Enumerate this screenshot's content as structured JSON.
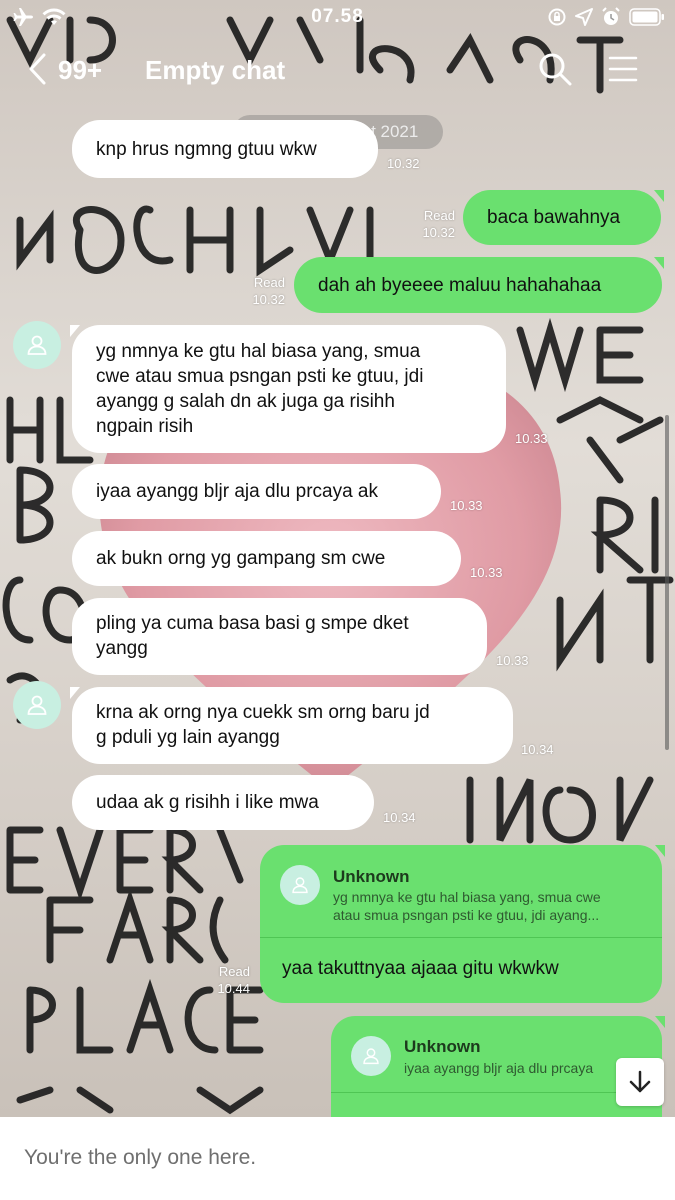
{
  "status_bar": {
    "time": "07.58"
  },
  "header": {
    "unread_count": "99+",
    "title": "Empty chat"
  },
  "date_chip": "Mon, 16 August 2021",
  "messages": [
    {
      "text": "knp hrus ngmng gtuu wkw",
      "time": "10.32"
    },
    {
      "text": "baca bawahnya",
      "read": "Read",
      "time": "10.32"
    },
    {
      "text": "dah ah byeeee maluu hahahahaa",
      "read": "Read",
      "time": "10.32"
    },
    {
      "text_lines": [
        "yg nmnya ke gtu hal biasa yang, smua",
        "cwe atau smua psngan psti ke gtuu, jdi",
        "ayangg g salah dn ak juga ga risihh",
        "ngpain risih"
      ],
      "time": "10.33"
    },
    {
      "text": "iyaa ayangg bljr aja dlu prcaya ak",
      "time": "10.33"
    },
    {
      "text": "ak bukn orng yg gampang sm cwe",
      "time": "10.33"
    },
    {
      "text_lines": [
        "pling ya cuma basa basi g smpe dket",
        "yangg"
      ],
      "time": "10.33"
    },
    {
      "text_lines": [
        "krna ak orng nya cuekk sm orng baru jd",
        "g pduli yg lain ayangg"
      ],
      "time": "10.34"
    },
    {
      "text": "udaa ak g risihh i like mwa",
      "time": "10.34"
    }
  ],
  "replies": [
    {
      "name": "Unknown",
      "snippet_lines": [
        "yg nmnya ke gtu hal biasa yang, smua cwe",
        "atau smua psngan psti ke gtuu, jdi ayang..."
      ],
      "text": "yaa takuttnyaa ajaaa gitu wkwkw",
      "read": "Read",
      "time": "10.44"
    },
    {
      "name": "Unknown",
      "snippet_lines": [
        "iyaa ayangg bljr aja dlu prcaya"
      ]
    }
  ],
  "footer": {
    "text": "You're the only one here."
  }
}
